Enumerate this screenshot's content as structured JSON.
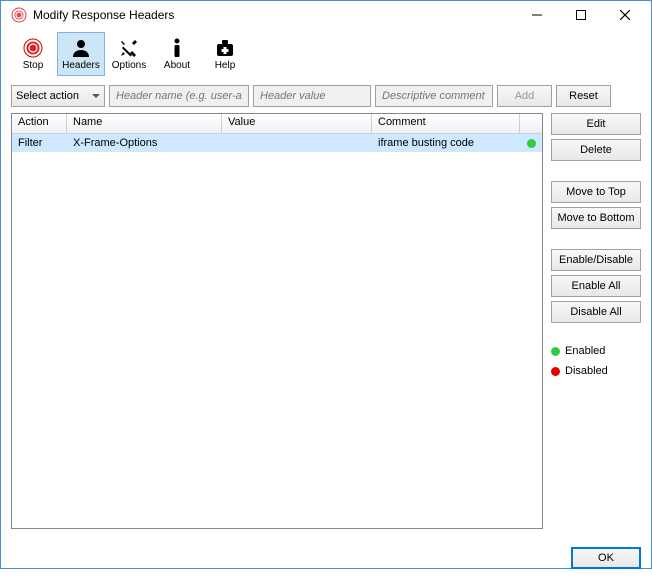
{
  "window": {
    "title": "Modify Response Headers",
    "minimize": "—",
    "maximize": "☐",
    "close": "✕"
  },
  "toolbar": {
    "stop": "Stop",
    "headers": "Headers",
    "options": "Options",
    "about": "About",
    "help": "Help"
  },
  "inputs": {
    "select_action": "Select action",
    "header_name_ph": "Header name (e.g. user-agent)",
    "header_value_ph": "Header value",
    "comment_ph": "Descriptive comment",
    "add": "Add",
    "reset": "Reset"
  },
  "table": {
    "headers": {
      "action": "Action",
      "name": "Name",
      "value": "Value",
      "comment": "Comment"
    },
    "rows": [
      {
        "action": "Filter",
        "name": "X-Frame-Options",
        "value": "",
        "comment": "iframe busting code",
        "status": "enabled"
      }
    ]
  },
  "side": {
    "edit": "Edit",
    "delete": "Delete",
    "move_top": "Move to Top",
    "move_bottom": "Move to Bottom",
    "enable_disable": "Enable/Disable",
    "enable_all": "Enable All",
    "disable_all": "Disable All"
  },
  "legend": {
    "enabled": "Enabled",
    "disabled": "Disabled"
  },
  "footer": {
    "ok": "OK"
  }
}
